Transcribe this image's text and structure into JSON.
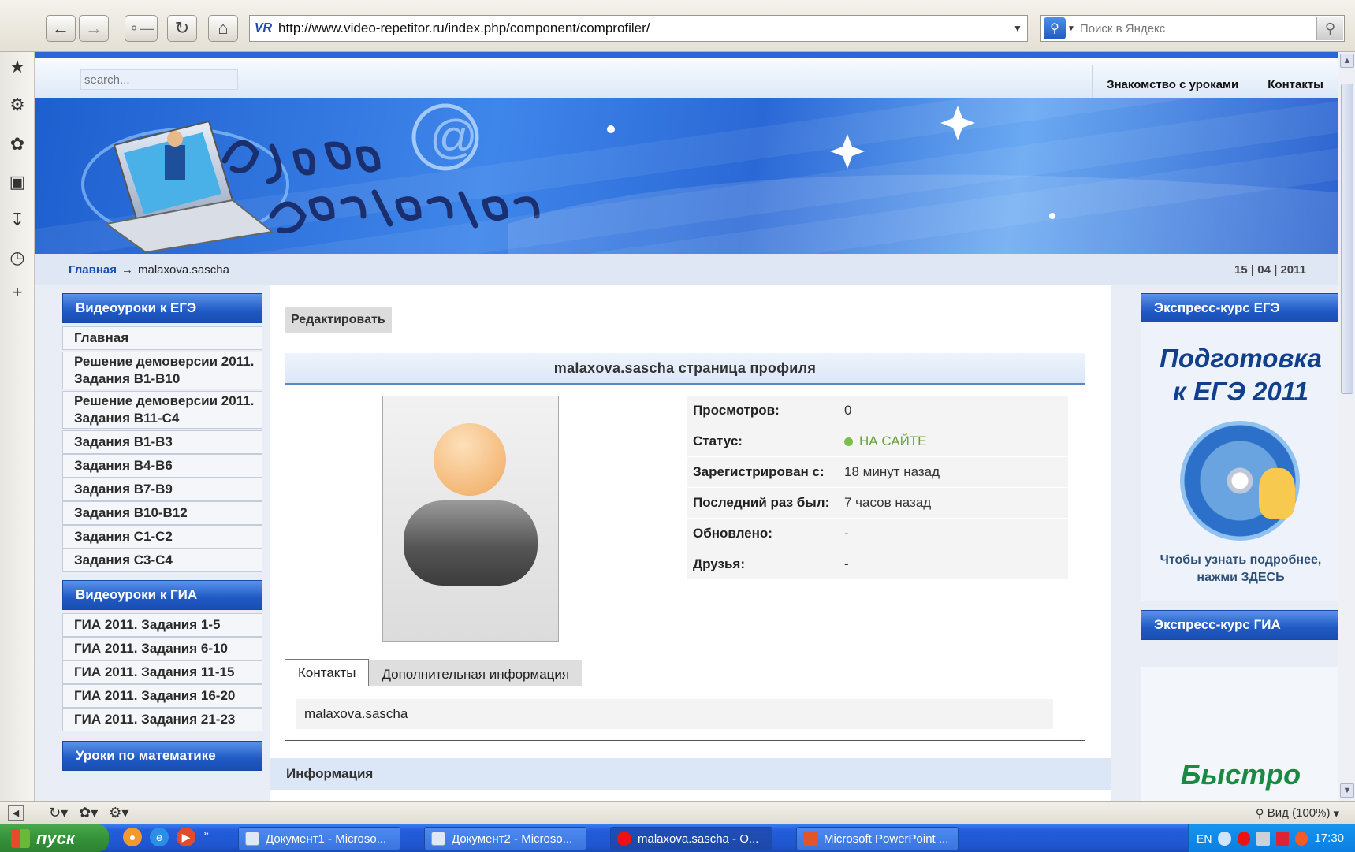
{
  "browser": {
    "url": "http://www.video-repetitor.ru/index.php/component/comprofiler/",
    "site_icon_text": "VR",
    "search_placeholder": "Поиск в Яндекс",
    "search_engine_icon": "yandex-search-icon",
    "nav_icons": [
      "back-arrow-icon",
      "forward-arrow-icon",
      "key-icon",
      "reload-icon",
      "home-icon"
    ]
  },
  "sidebar_strip_icons": [
    "favorites-icon",
    "settings-icon",
    "tools-icon",
    "notes-icon",
    "downloads-icon",
    "history-icon",
    "add-icon"
  ],
  "site": {
    "search_placeholder": "search...",
    "topnav": [
      "Знакомство с уроками",
      "Контакты"
    ],
    "breadcrumb": {
      "home": "Главная",
      "separator": "→",
      "current": "malaxova.sascha"
    },
    "date": "15 | 04 | 2011"
  },
  "left_menu": {
    "section1_title": "Видеоуроки к ЕГЭ",
    "section1_items": [
      "Главная",
      "Решение демоверсии 2011. Задания В1-В10",
      "Решение демоверсии 2011. Задания В11-С4",
      "Задания В1-В3",
      "Задания В4-В6",
      "Задания В7-В9",
      "Задания В10-В12",
      "Задания С1-С2",
      "Задания С3-С4"
    ],
    "section2_title": "Видеоуроки к ГИА",
    "section2_items": [
      "ГИА 2011. Задания 1-5",
      "ГИА 2011. Задания 6-10",
      "ГИА 2011. Задания 11-15",
      "ГИА 2011. Задания 16-20",
      "ГИА 2011. Задания 21-23"
    ],
    "section3_title": "Уроки по математике"
  },
  "profile": {
    "edit_label": "Редактировать",
    "title": "malaxova.sascha страница профиля",
    "stats": [
      {
        "label": "Просмотров:",
        "value": "0"
      },
      {
        "label": "Статус:",
        "value": "НА САЙТЕ"
      },
      {
        "label": "Зарегистрирован с:",
        "value": "18 минут назад"
      },
      {
        "label": "Последний раз был:",
        "value": "7 часов назад"
      },
      {
        "label": "Обновлено:",
        "value": "-"
      },
      {
        "label": "Друзья:",
        "value": "-"
      }
    ],
    "tabs": [
      "Контакты",
      "Дополнительная информация"
    ],
    "contact_value": "malaxova.sascha",
    "info_heading": "Информация",
    "status_color": "#6aa23a"
  },
  "right_col": {
    "ege_title": "Экспресс-курс ЕГЭ",
    "ege_promo_line1": "Подготовка",
    "ege_promo_line2": "к ЕГЭ 2011",
    "ege_text": "Чтобы узнать подробнее, нажми",
    "ege_link": "ЗДЕСЬ",
    "gia_title": "Экспресс-курс ГИА",
    "gia_promo": "Быстро"
  },
  "statusbar": {
    "zoom": "Вид (100%)"
  },
  "taskbar": {
    "start": "пуск",
    "tasks": [
      "Документ1 - Microso...",
      "Документ2 - Microso...",
      "malaxova.sascha - O...",
      "Microsoft PowerPoint ..."
    ],
    "lang": "EN",
    "clock": "17:30"
  }
}
